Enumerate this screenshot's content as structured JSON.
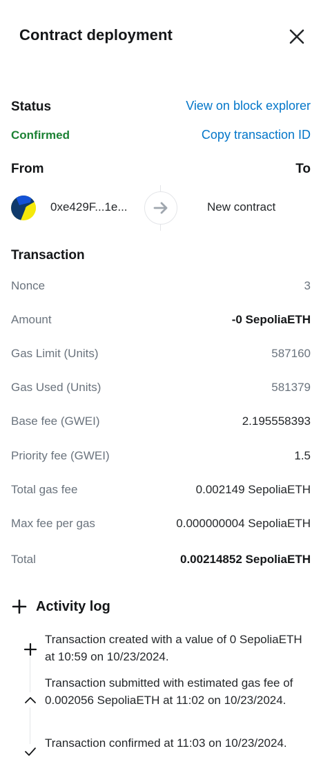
{
  "header": {
    "title": "Contract deployment"
  },
  "status": {
    "label": "Status",
    "value": "Confirmed",
    "view_explorer": "View on block explorer",
    "copy_txid": "Copy transaction ID"
  },
  "parties": {
    "from_label": "From",
    "to_label": "To",
    "from_address": "0xe429F...1e...",
    "to_address": "New contract"
  },
  "transaction": {
    "title": "Transaction",
    "rows": [
      {
        "key": "Nonce",
        "value": "3"
      },
      {
        "key": "Amount",
        "value": "-0 SepoliaETH"
      },
      {
        "key": "Gas Limit (Units)",
        "value": "587160"
      },
      {
        "key": "Gas Used (Units)",
        "value": "581379"
      },
      {
        "key": "Base fee (GWEI)",
        "value": "2.195558393"
      },
      {
        "key": "Priority fee (GWEI)",
        "value": "1.5"
      },
      {
        "key": "Total gas fee",
        "value": "0.002149 SepoliaETH"
      },
      {
        "key": "Max fee per gas",
        "value": "0.000000004 SepoliaETH"
      },
      {
        "key": "Total",
        "value": "0.00214852 SepoliaETH"
      }
    ]
  },
  "activity": {
    "title": "Activity log",
    "entries": [
      {
        "icon": "plus-icon",
        "text": "Transaction created with a value of 0 SepoliaETH at 10:59 on 10/23/2024."
      },
      {
        "icon": "chevron-up-icon",
        "text": "Transaction submitted with estimated gas fee of 0.002056 SepoliaETH at 11:02 on 10/23/2024."
      },
      {
        "icon": "check-icon",
        "text": "Transaction confirmed at 11:03 on 10/23/2024."
      }
    ]
  },
  "colors": {
    "link": "#0376c9",
    "success": "#1c8234",
    "muted": "#6a737d",
    "text": "#24272a"
  }
}
